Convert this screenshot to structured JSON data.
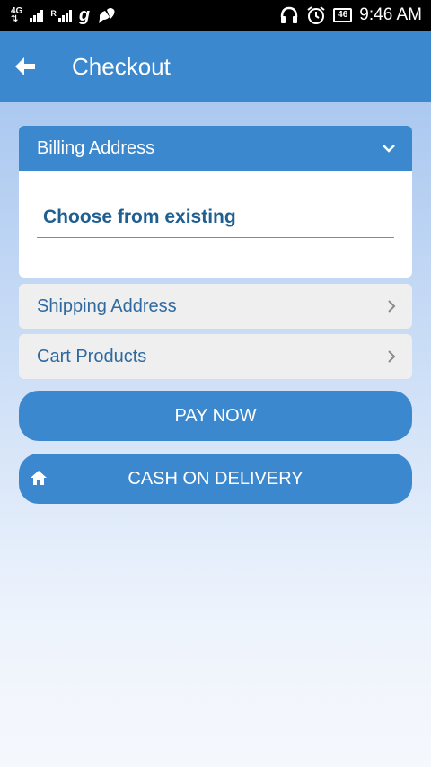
{
  "status_bar": {
    "network": "4G",
    "roaming": "R",
    "carrier_icon": "g",
    "battery": "46",
    "time": "9:46 AM"
  },
  "app_bar": {
    "title": "Checkout"
  },
  "billing": {
    "header": "Billing Address",
    "choose_label": "Choose from existing"
  },
  "shipping": {
    "label": "Shipping Address"
  },
  "cart": {
    "label": "Cart Products"
  },
  "actions": {
    "pay_now": "PAY NOW",
    "cash_on_delivery": "CASH ON DELIVERY"
  },
  "colors": {
    "primary": "#3b88cf",
    "text_dark_blue": "#1f5f91",
    "collapsed_bg": "#efefef"
  }
}
